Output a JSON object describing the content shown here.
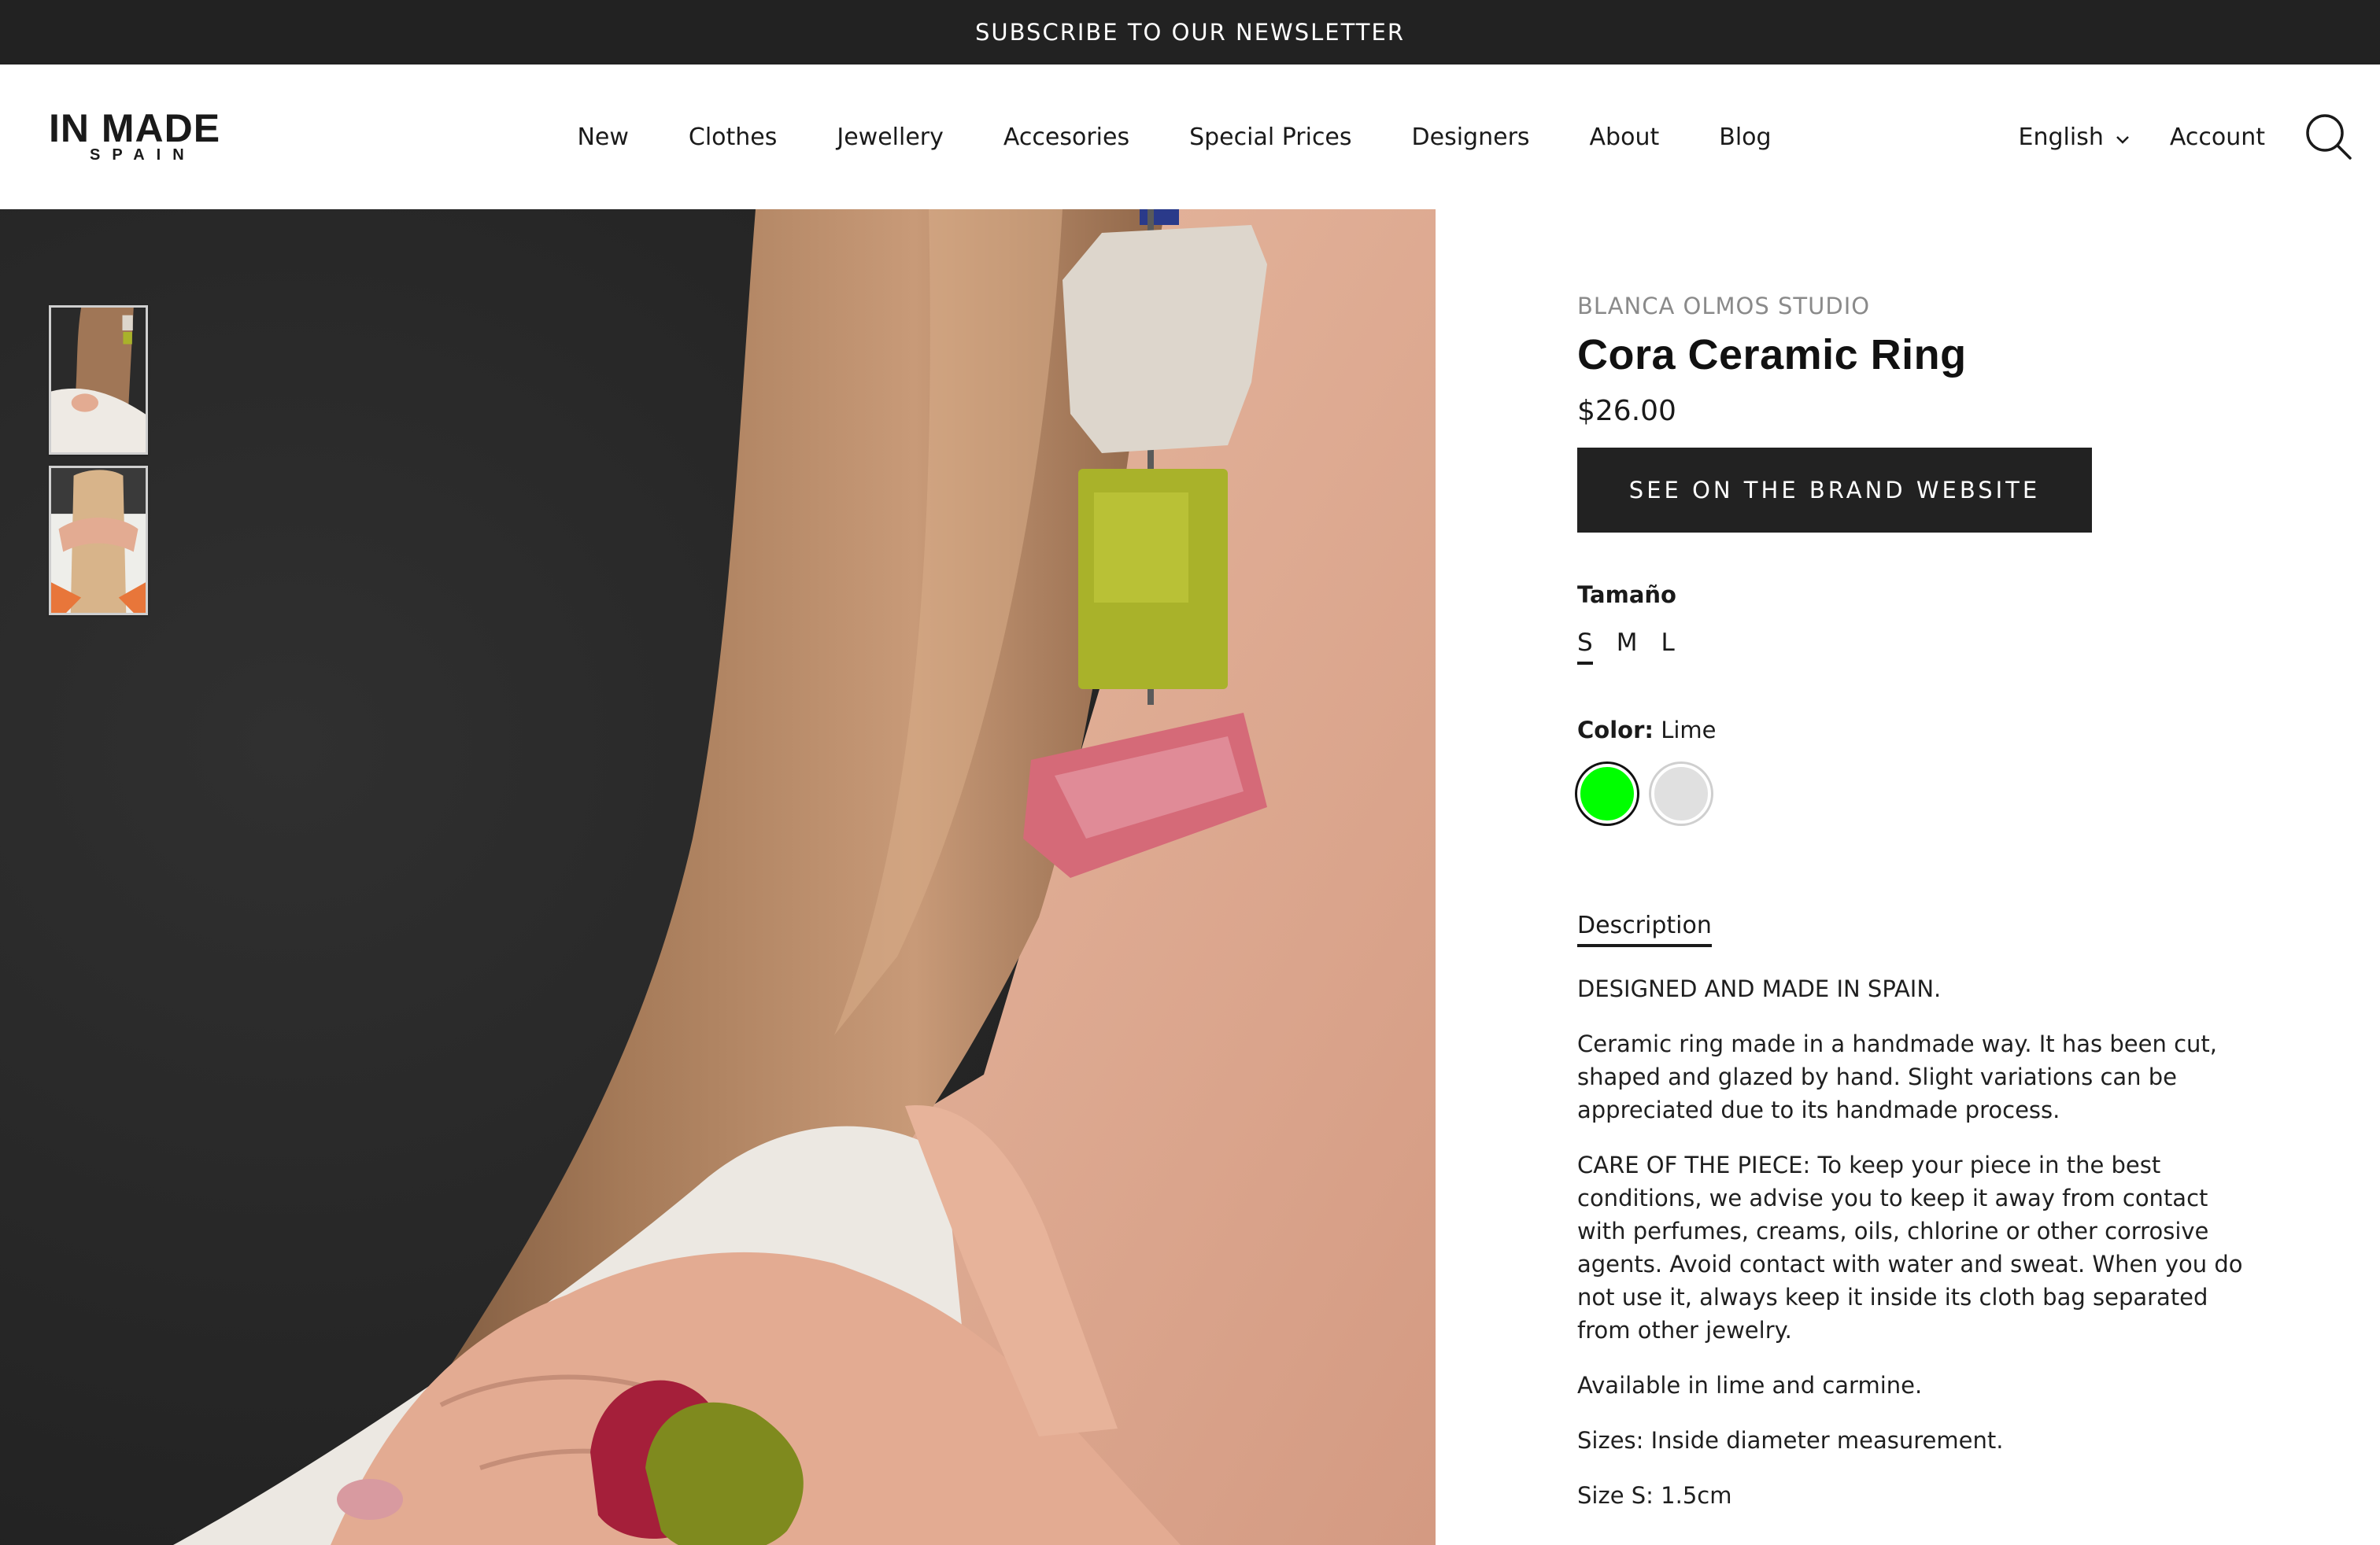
{
  "announcement": {
    "text": "SUBSCRIBE TO OUR NEWSLETTER"
  },
  "logo": {
    "main": "IN MADE",
    "sub": "SPAIN"
  },
  "nav": {
    "items": [
      {
        "label": "New"
      },
      {
        "label": "Clothes"
      },
      {
        "label": "Jewellery"
      },
      {
        "label": "Accesories"
      },
      {
        "label": "Special Prices"
      },
      {
        "label": "Designers"
      },
      {
        "label": "About"
      },
      {
        "label": "Blog"
      }
    ]
  },
  "header": {
    "language": "English",
    "account": "Account",
    "icons": {
      "language_caret": "chevron-down-icon",
      "search": "search-icon"
    }
  },
  "product": {
    "brand": "BLANCA OLMOS STUDIO",
    "title": "Cora Ceramic Ring",
    "price": "$26.00",
    "cta": "SEE ON THE BRAND WEBSITE",
    "size_label": "Tamaño",
    "sizes": [
      "S",
      "M",
      "L"
    ],
    "selected_size": "S",
    "color_label": "Color:",
    "color_value": "Lime",
    "colors": [
      {
        "name": "Lime",
        "hex": "#00ff00",
        "selected": true
      },
      {
        "name": "Carmine",
        "hex": "#e0e0e0",
        "selected": false
      }
    ],
    "description_tab": "Description",
    "description": [
      "DESIGNED AND MADE IN SPAIN.",
      "Ceramic ring made in a handmade way. It has been cut, shaped and glazed by hand. Slight variations can be appreciated due to its handmade process.",
      "CARE OF THE PIECE: To keep your piece in the best conditions, we advise you to keep it away from contact with perfumes, creams, oils, chlorine or other corrosive agents. Avoid contact with water and sweat. When you do not use it, always keep it inside its cloth bag separated from other jewelry.",
      "Available in lime and carmine.",
      "Sizes: Inside diameter measurement.",
      "Size S: 1.5cm"
    ],
    "thumbnail_count": 2
  },
  "colors": {
    "topbar": "#222222",
    "button": "#222222",
    "brand_text": "#8a8a8a"
  }
}
